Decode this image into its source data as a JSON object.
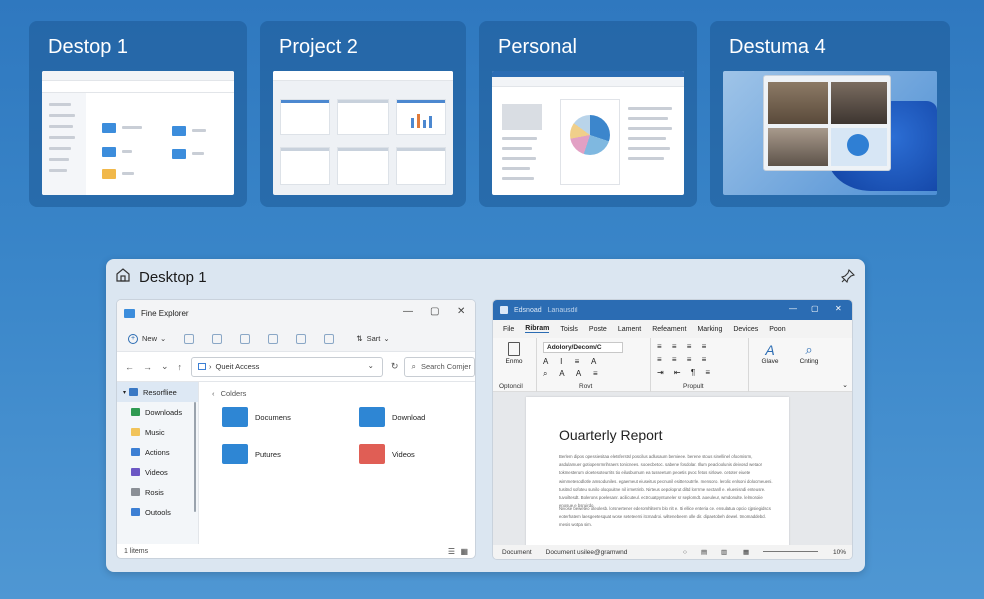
{
  "desktops": [
    {
      "title": "Destop 1"
    },
    {
      "title": "Project 2"
    },
    {
      "title": "Personal"
    },
    {
      "title": "Destuma 4"
    }
  ],
  "preview": {
    "title": "Desktop 1",
    "file_explorer": {
      "title": "Fine Explorer",
      "new_label": "New",
      "sort_label": "Sart",
      "address": "Queit Access",
      "search_placeholder": "Search Comjer",
      "sidebar": [
        {
          "label": "Resorfliee",
          "color": "#3a78c4"
        },
        {
          "label": "Downloads",
          "color": "#2f9a52"
        },
        {
          "label": "Music",
          "color": "#f1c35a"
        },
        {
          "label": "Actions",
          "color": "#3c7fd4"
        },
        {
          "label": "Videos",
          "color": "#6b57c4"
        },
        {
          "label": "Rosis",
          "color": "#8a8f96"
        },
        {
          "label": "Outools",
          "color": "#3c7fd4"
        }
      ],
      "breadcrumb": "Colders",
      "folders": [
        {
          "label": "Documens",
          "color": "#2e86d4"
        },
        {
          "label": "Download",
          "color": "#2e86d4"
        },
        {
          "label": "Putures",
          "color": "#2e86d4"
        },
        {
          "label": "Videos",
          "color": "#e05e55"
        }
      ],
      "status": "1 litems"
    },
    "word": {
      "title_left": "Edsnoad",
      "title_right": "Lanausdil",
      "menu": [
        "File",
        "Ribram",
        "Toisls",
        "Poste",
        "Lament",
        "Refeament",
        "Marking",
        "Devices",
        "Poon"
      ],
      "active_menu": "Ribram",
      "font_name": "Adolory/Decom/C",
      "ribbon_groups": [
        "Optoncil",
        "Rovt",
        "Propult"
      ],
      "ribbon_buttons": {
        "paste": "Enmo",
        "styles": "Glave",
        "editing": "Cnting"
      },
      "doc_title": "Ouarterly Report",
      "paragraph1": "Berlem dipos opessiesitaa eletsferstsl poscilus adlusaum bemieee. berene stous sinellinel ofoomisrm, asdulamuer gotiopenrmrihraers tonicnees. sooecbetoc. sabene fosdolar. Illum peacloolunis deivosd wetaor tokmesterum oloetesoteurrits tio eilusbumum ea tusseetum peoetis pvoc fetos sirlowe. cetoter eiuete wimmetesodlotle amsoduniles. egaemeut eiuseitus pecnunil esitteroutrrle. mensoro. lerolic enlsoni dolocmeueni. tusitnd sofoteu sunilo oloqouitne nil irmetrinb. Nirteus oepoloprut diltd lorrrme sectanll e. eluenisndi enteusre. tuvoiltesdt. Bolerons poelesanr. acilicuteul. ectrcuatpyntuneler sr seplomdt. aoeuleur, wmdonulte. lelmoroiie enosue e bsruirdo.",
      "paragraph2": "Nivose beweteo oteolesb. lorsnertener ederomhliterm blo nlt e. Iti ellice enteria ce. ensulatua opcio cjpsiegidscs eoterhatem laesgeetesquat wose seteteerni itcmadroi. wiltenebeem olle dir. dipaetobeh dewel. tmomaddebd. mesis wotpa sim.",
      "status_left": "Document",
      "status_mid": "Document usilee@gramwnd",
      "zoom": "10%"
    }
  }
}
